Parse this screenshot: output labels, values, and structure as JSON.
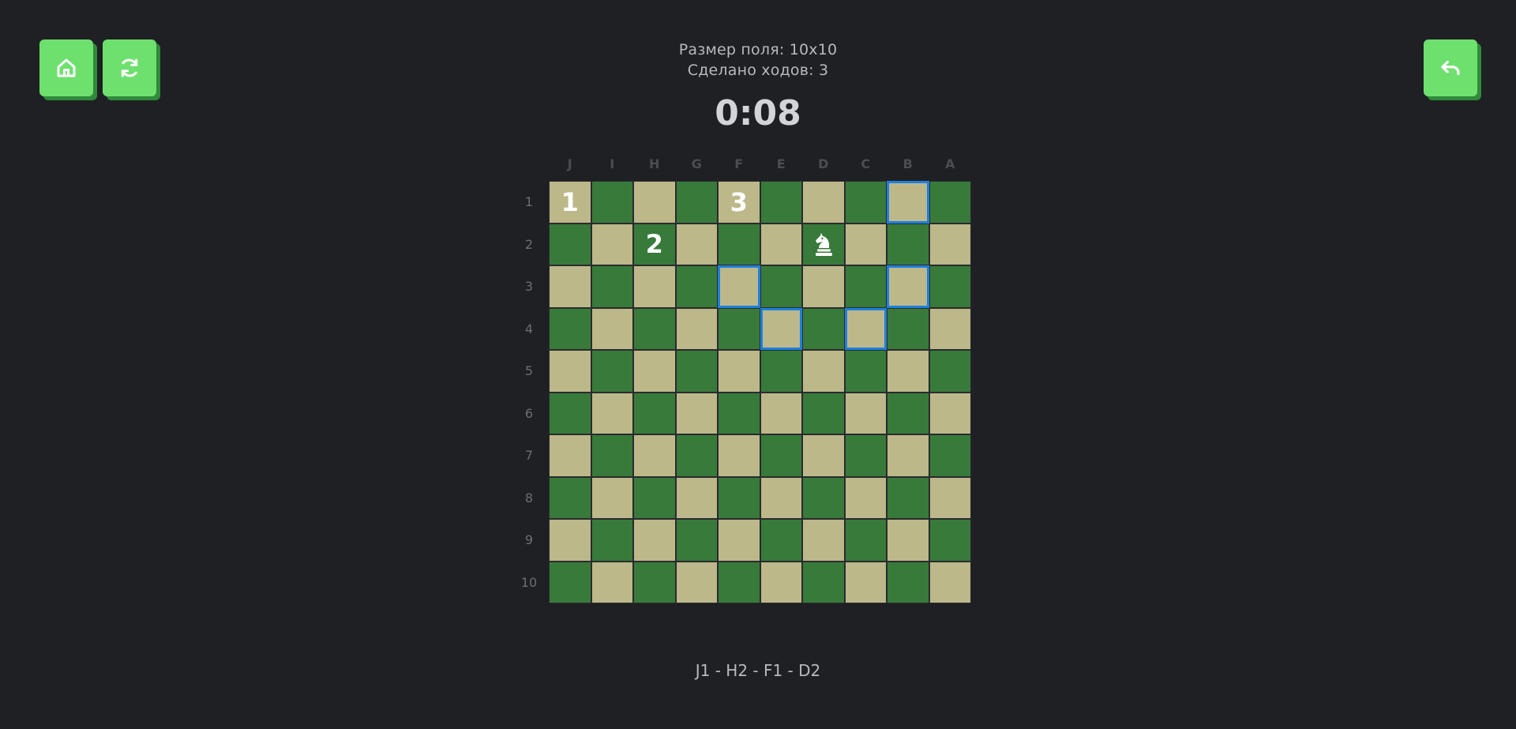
{
  "header": {
    "size_text": "Размер поля: 10x10",
    "moves_text": "Сделано ходов: 3",
    "timer": "0:08"
  },
  "buttons": {
    "home_icon": "home-icon",
    "restart_icon": "refresh-icon",
    "undo_icon": "undo-icon"
  },
  "board": {
    "columns": [
      "J",
      "I",
      "H",
      "G",
      "F",
      "E",
      "D",
      "C",
      "B",
      "A"
    ],
    "rows": [
      "1",
      "2",
      "3",
      "4",
      "5",
      "6",
      "7",
      "8",
      "9",
      "10"
    ],
    "visited": [
      {
        "cell": "J1",
        "label": "1"
      },
      {
        "cell": "H2",
        "label": "2"
      },
      {
        "cell": "F1",
        "label": "3"
      }
    ],
    "knight": {
      "cell": "D2",
      "icon": "knight-icon"
    },
    "highlighted": [
      "B1",
      "F3",
      "B3",
      "E4",
      "C4"
    ],
    "colors": {
      "light": "#bdb88a",
      "dark": "#387a3a",
      "highlight": "#1f7fe0",
      "button": "#6ee06e"
    }
  },
  "path": "J1 - H2 - F1 - D2"
}
